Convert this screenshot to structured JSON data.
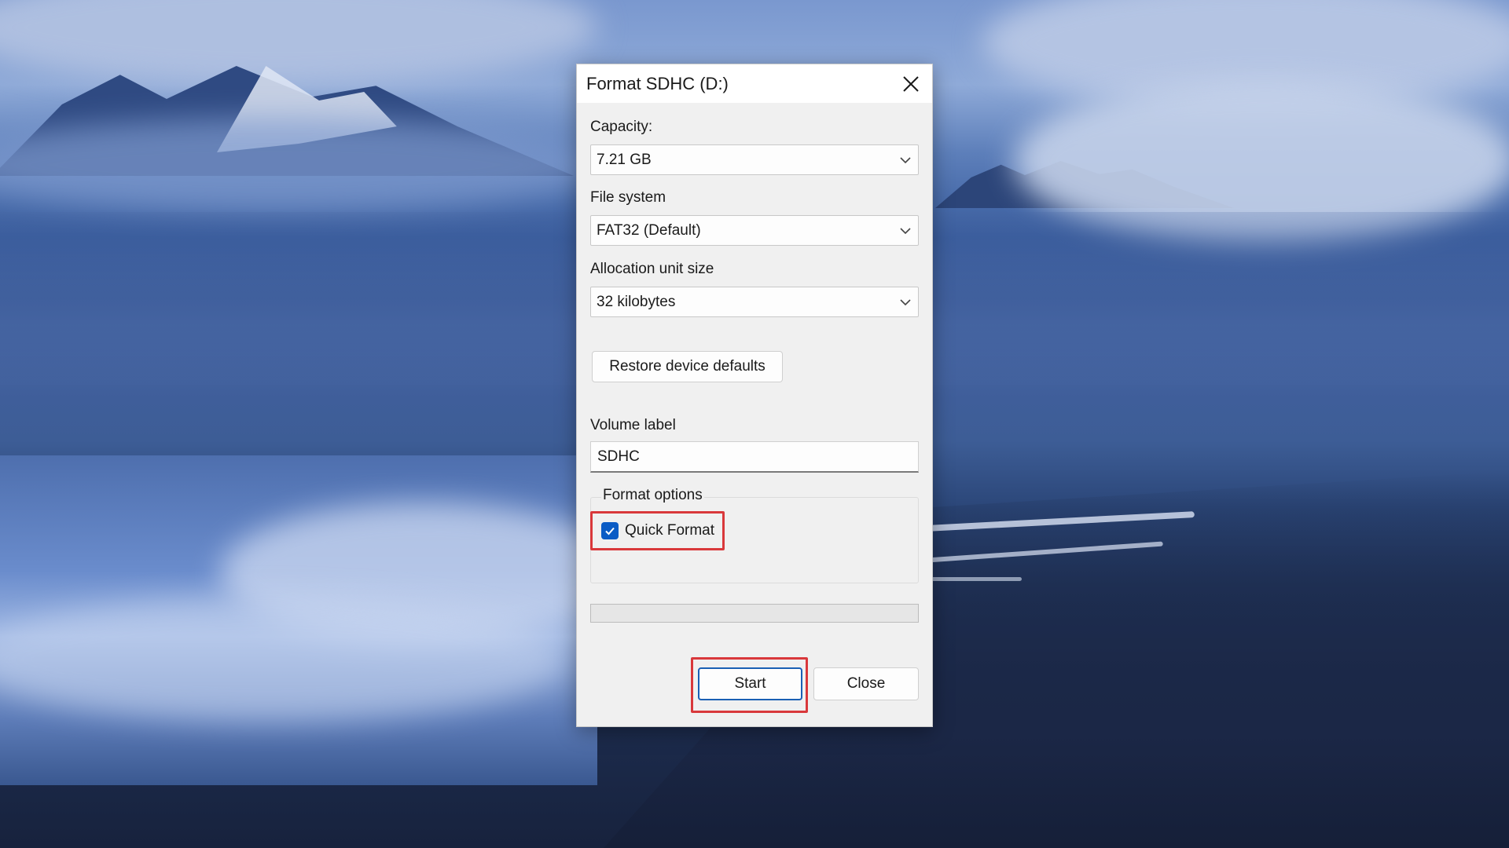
{
  "dialog": {
    "title": "Format SDHC (D:)",
    "close_icon": "close-icon"
  },
  "capacity": {
    "label": "Capacity:",
    "value": "7.21 GB"
  },
  "file_system": {
    "label": "File system",
    "value": "FAT32 (Default)"
  },
  "allocation": {
    "label": "Allocation unit size",
    "value": "32 kilobytes"
  },
  "restore_button": {
    "label": "Restore device defaults"
  },
  "volume_label": {
    "label": "Volume label",
    "value": "SDHC"
  },
  "format_options": {
    "title": "Format options",
    "quick_format": {
      "label": "Quick Format",
      "checked": true
    }
  },
  "progress": {
    "fraction": 0
  },
  "buttons": {
    "start": "Start",
    "close": "Close"
  },
  "colors": {
    "highlight": "#d9383b",
    "accent": "#0b5cc5"
  }
}
